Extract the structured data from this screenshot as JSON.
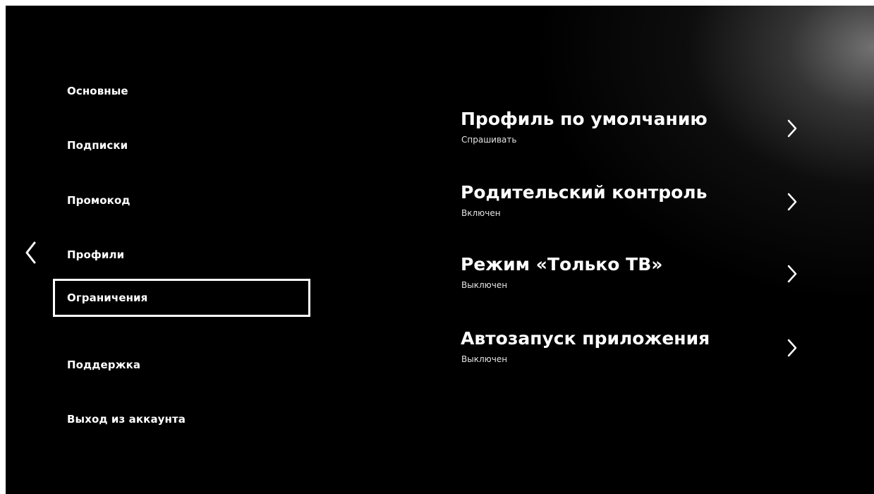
{
  "sidebar": {
    "back_icon": "chevron-left-icon",
    "items": [
      {
        "label": "Основные",
        "selected": false
      },
      {
        "label": "Подписки",
        "selected": false
      },
      {
        "label": "Промокод",
        "selected": false
      },
      {
        "label": "Профили",
        "selected": false
      },
      {
        "label": "Ограничения",
        "selected": true
      },
      {
        "label": "Поддержка",
        "selected": false
      },
      {
        "label": "Выход из аккаунта",
        "selected": false
      }
    ]
  },
  "settings": {
    "chevron_icon": "chevron-right-icon",
    "options": [
      {
        "title": "Профиль по умолчанию",
        "value": "Спрашивать"
      },
      {
        "title": "Родительский контроль",
        "value": "Включен"
      },
      {
        "title": "Режим «Только ТВ»",
        "value": "Выключен"
      },
      {
        "title": "Автозапуск приложения",
        "value": "Выключен"
      }
    ]
  },
  "colors": {
    "background": "#000000",
    "text": "#ffffff",
    "secondary_text": "#e4e4e4",
    "focus_border": "#ffffff"
  }
}
